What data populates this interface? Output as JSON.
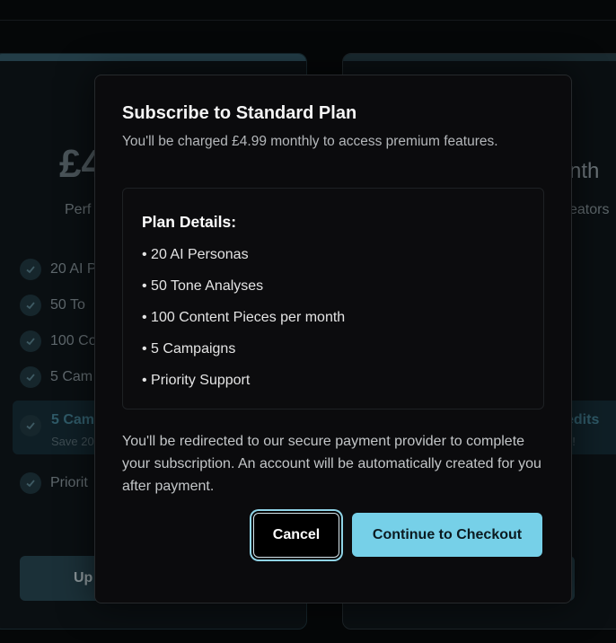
{
  "background": {
    "left_card": {
      "price": "£4",
      "subtitle": "Perf",
      "features": [
        "20 AI P",
        "50 To",
        "100 Co",
        "5 Cam"
      ],
      "highlight_title": "5 Cam",
      "highlight_sub": "Save 20",
      "last_feature": "Priorit",
      "button_label": "Up"
    },
    "right_card": {
      "price_suffix": "nth",
      "subtitle": "eators",
      "highlight_title": "edits",
      "highlight_sub": "n!",
      "button_label": "n"
    }
  },
  "modal": {
    "title": "Subscribe to Standard Plan",
    "description": "You'll be charged £4.99 monthly to access premium features.",
    "details_heading": "Plan Details:",
    "details_items": [
      "• 20 AI Personas",
      "• 50 Tone Analyses",
      "• 100 Content Pieces per month",
      "• 5 Campaigns",
      "• Priority Support"
    ],
    "note": "You'll be redirected to our secure payment provider to complete your subscription. An account will be automatically created for you after payment.",
    "cancel_label": "Cancel",
    "checkout_label": "Continue to Checkout"
  },
  "colors": {
    "accent": "#76d0e8",
    "modal_bg": "#0b0b0d",
    "page_bg": "#050708"
  }
}
